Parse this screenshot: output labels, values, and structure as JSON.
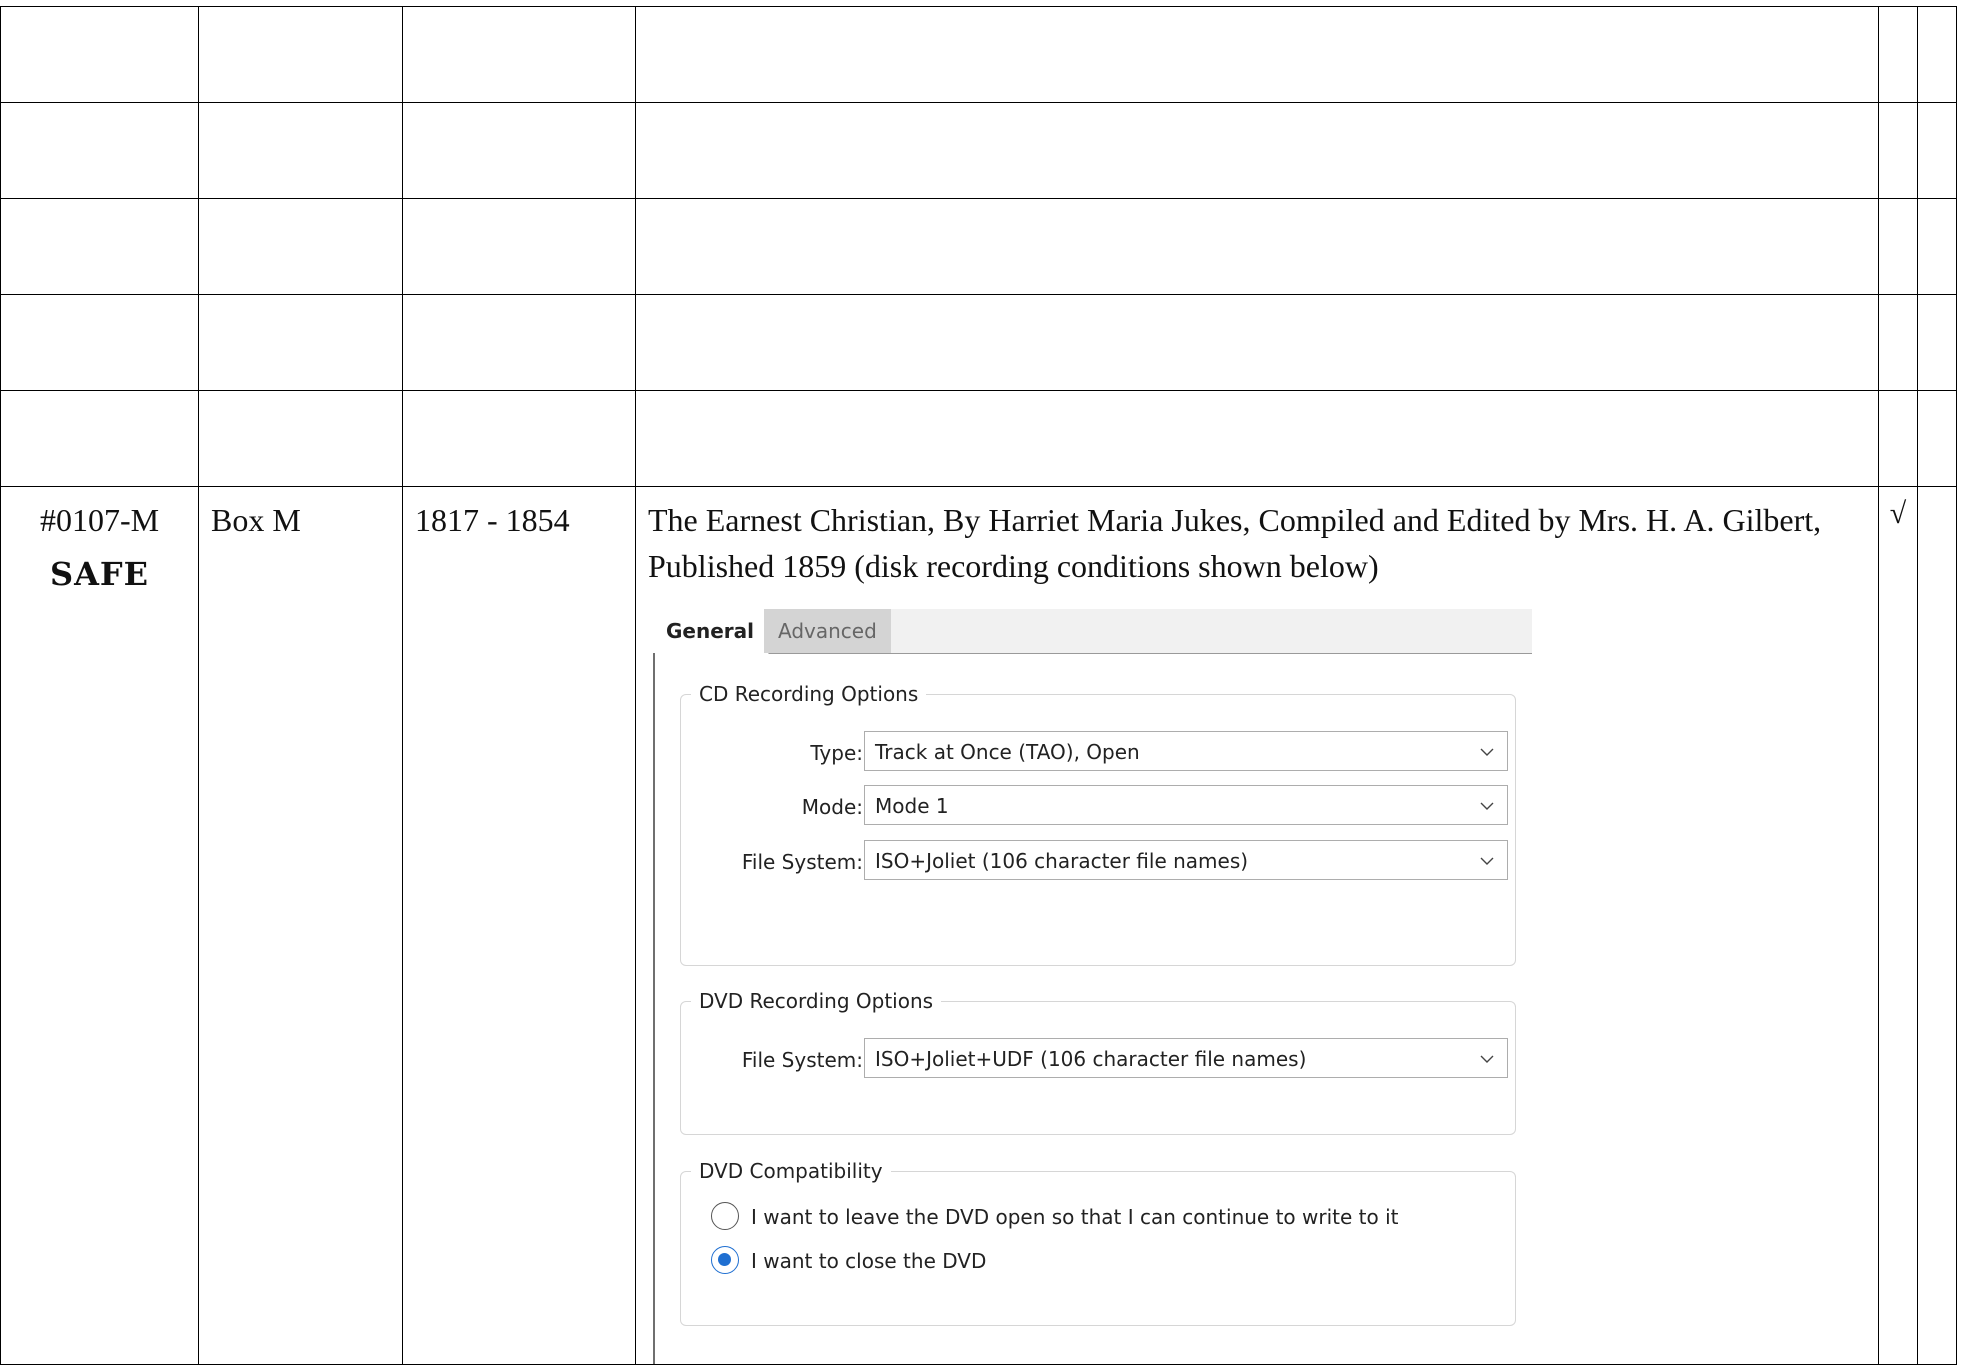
{
  "row": {
    "id": "#0107-M",
    "stamp": "SAFE",
    "box": "Box M",
    "years": "1817 - 1854",
    "description": "The Earnest Christian, By Harriet Maria Jukes, Compiled and Edited by Mrs. H. A. Gilbert, Published 1859 (disk recording conditions shown below)",
    "check": "√"
  },
  "dialog": {
    "tabs": [
      {
        "label": "General",
        "active": true
      },
      {
        "label": "Advanced",
        "active": false
      }
    ],
    "cd_group": {
      "legend": "CD Recording Options",
      "fields": [
        {
          "label": "Type:",
          "value": "Track at Once (TAO), Open"
        },
        {
          "label": "Mode:",
          "value": "Mode 1"
        },
        {
          "label": "File System:",
          "value": "ISO+Joliet (106 character file names)"
        }
      ]
    },
    "dvd_group": {
      "legend": "DVD Recording Options",
      "fields": [
        {
          "label": "File System:",
          "value": "ISO+Joliet+UDF (106 character file names)"
        }
      ]
    },
    "compat_group": {
      "legend": "DVD Compatibility",
      "options": [
        {
          "label": "I want to leave the DVD open so that I can continue to write to it",
          "selected": false
        },
        {
          "label": "I want to close the DVD",
          "selected": true
        }
      ]
    }
  },
  "colors": {
    "radio_accent": "#1f6fd1",
    "border": "#000000"
  }
}
